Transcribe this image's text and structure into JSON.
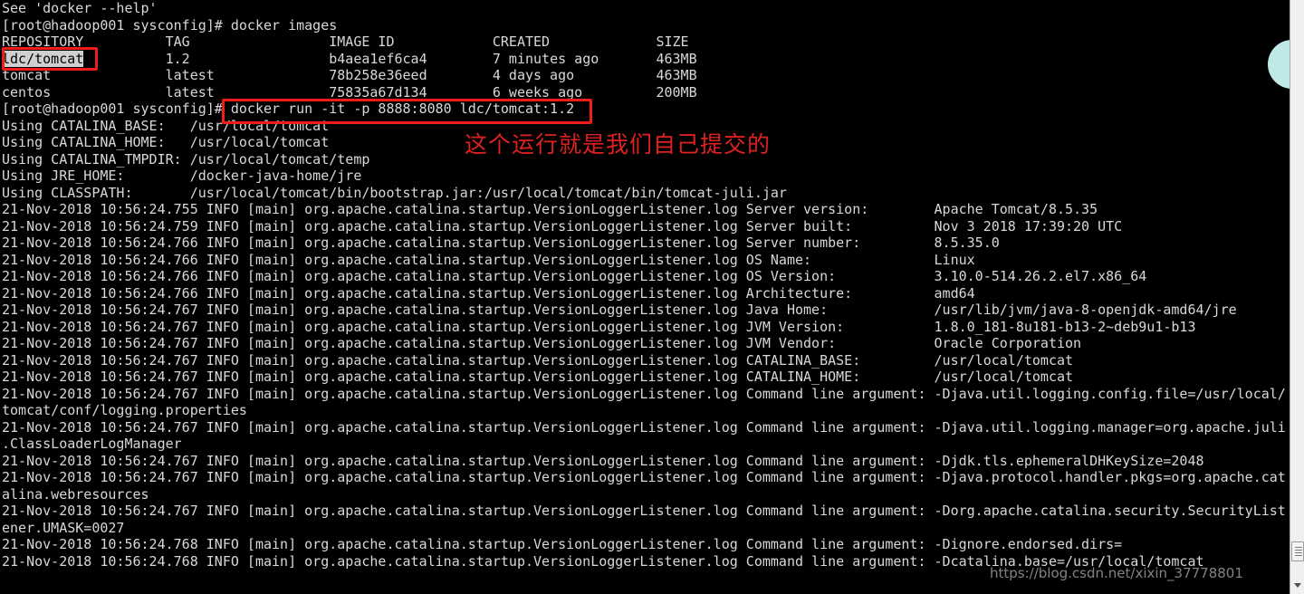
{
  "terminal": {
    "prompt": "[root@hadoop001 sysconfig]#",
    "lines": [
      {
        "id": "help-hint",
        "text": "See 'docker --help'"
      },
      {
        "id": "cmd-docker-images",
        "text": "[root@hadoop001 sysconfig]# docker images"
      },
      {
        "id": "images-header",
        "text": "REPOSITORY          TAG                 IMAGE ID            CREATED             SIZE"
      },
      {
        "id": "image-row-1",
        "pre": "",
        "sel": "ldc/tomcat",
        "post": "          1.2                 b4aea1ef6ca4        7 minutes ago       463MB"
      },
      {
        "id": "image-row-2",
        "text": "tomcat              latest              78b258e36eed        4 days ago          463MB"
      },
      {
        "id": "image-row-3",
        "text": "centos              latest              75835a67d134        6 weeks ago         200MB"
      },
      {
        "id": "cmd-docker-run",
        "text": "[root@hadoop001 sysconfig]# docker run -it -p 8888:8080 ldc/tomcat:1.2"
      },
      {
        "id": "catalina-base",
        "text": "Using CATALINA_BASE:   /usr/local/tomcat"
      },
      {
        "id": "catalina-home",
        "text": "Using CATALINA_HOME:   /usr/local/tomcat"
      },
      {
        "id": "catalina-tmpdir",
        "text": "Using CATALINA_TMPDIR: /usr/local/tomcat/temp"
      },
      {
        "id": "jre-home",
        "text": "Using JRE_HOME:        /docker-java-home/jre"
      },
      {
        "id": "classpath",
        "text": "Using CLASSPATH:       /usr/local/tomcat/bin/bootstrap.jar:/usr/local/tomcat/bin/tomcat-juli.jar"
      },
      {
        "id": "log-server-version",
        "text": "21-Nov-2018 10:56:24.755 INFO [main] org.apache.catalina.startup.VersionLoggerListener.log Server version:        Apache Tomcat/8.5.35"
      },
      {
        "id": "log-server-built",
        "text": "21-Nov-2018 10:56:24.759 INFO [main] org.apache.catalina.startup.VersionLoggerListener.log Server built:          Nov 3 2018 17:39:20 UTC"
      },
      {
        "id": "log-server-number",
        "text": "21-Nov-2018 10:56:24.766 INFO [main] org.apache.catalina.startup.VersionLoggerListener.log Server number:         8.5.35.0"
      },
      {
        "id": "log-os-name",
        "text": "21-Nov-2018 10:56:24.766 INFO [main] org.apache.catalina.startup.VersionLoggerListener.log OS Name:               Linux"
      },
      {
        "id": "log-os-version",
        "text": "21-Nov-2018 10:56:24.766 INFO [main] org.apache.catalina.startup.VersionLoggerListener.log OS Version:            3.10.0-514.26.2.el7.x86_64"
      },
      {
        "id": "log-architecture",
        "text": "21-Nov-2018 10:56:24.766 INFO [main] org.apache.catalina.startup.VersionLoggerListener.log Architecture:          amd64"
      },
      {
        "id": "log-java-home",
        "text": "21-Nov-2018 10:56:24.767 INFO [main] org.apache.catalina.startup.VersionLoggerListener.log Java Home:             /usr/lib/jvm/java-8-openjdk-amd64/jre"
      },
      {
        "id": "log-jvm-version",
        "text": "21-Nov-2018 10:56:24.767 INFO [main] org.apache.catalina.startup.VersionLoggerListener.log JVM Version:           1.8.0_181-8u181-b13-2~deb9u1-b13"
      },
      {
        "id": "log-jvm-vendor",
        "text": "21-Nov-2018 10:56:24.767 INFO [main] org.apache.catalina.startup.VersionLoggerListener.log JVM Vendor:            Oracle Corporation"
      },
      {
        "id": "log-catalina-base",
        "text": "21-Nov-2018 10:56:24.767 INFO [main] org.apache.catalina.startup.VersionLoggerListener.log CATALINA_BASE:         /usr/local/tomcat"
      },
      {
        "id": "log-catalina-home",
        "text": "21-Nov-2018 10:56:24.767 INFO [main] org.apache.catalina.startup.VersionLoggerListener.log CATALINA_HOME:         /usr/local/tomcat"
      },
      {
        "id": "log-arg-logging-config",
        "text": "21-Nov-2018 10:56:24.767 INFO [main] org.apache.catalina.startup.VersionLoggerListener.log Command line argument: -Djava.util.logging.config.file=/usr/local/"
      },
      {
        "id": "log-arg-logging-config-wrap",
        "text": "tomcat/conf/logging.properties"
      },
      {
        "id": "log-arg-logging-manager",
        "text": "21-Nov-2018 10:56:24.767 INFO [main] org.apache.catalina.startup.VersionLoggerListener.log Command line argument: -Djava.util.logging.manager=org.apache.juli"
      },
      {
        "id": "log-arg-logging-manager-wrap",
        "text": ".ClassLoaderLogManager"
      },
      {
        "id": "log-arg-dhkeysize",
        "text": "21-Nov-2018 10:56:24.767 INFO [main] org.apache.catalina.startup.VersionLoggerListener.log Command line argument: -Djdk.tls.ephemeralDHKeySize=2048"
      },
      {
        "id": "log-arg-protocol-handler",
        "text": "21-Nov-2018 10:56:24.767 INFO [main] org.apache.catalina.startup.VersionLoggerListener.log Command line argument: -Djava.protocol.handler.pkgs=org.apache.cat"
      },
      {
        "id": "log-arg-protocol-handler-wrap",
        "text": "alina.webresources"
      },
      {
        "id": "log-arg-security-listener",
        "text": "21-Nov-2018 10:56:24.767 INFO [main] org.apache.catalina.startup.VersionLoggerListener.log Command line argument: -Dorg.apache.catalina.security.SecurityList"
      },
      {
        "id": "log-arg-security-listener-wrap",
        "text": "ener.UMASK=0027"
      },
      {
        "id": "log-arg-ignore-endorsed",
        "text": "21-Nov-2018 10:56:24.768 INFO [main] org.apache.catalina.startup.VersionLoggerListener.log Command line argument: -Dignore.endorsed.dirs="
      },
      {
        "id": "log-arg-catalina-base",
        "text": "21-Nov-2018 10:56:24.768 INFO [main] org.apache.catalina.startup.VersionLoggerListener.log Command line argument: -Dcatalina.base=/usr/local/tomcat"
      }
    ]
  },
  "annotations": {
    "chinese_note": "这个运行就是我们自己提交的",
    "highlight_color": "#ef1c18",
    "note_color": "#e02020",
    "box_image_label": "ldc/tomcat",
    "box_command_label": "docker run -it -p 8888:8080 ldc/tomcat:1.2"
  },
  "watermark": {
    "text": "https://blog.csdn.net/xixin_37778801"
  },
  "scrollbar": {
    "position": "bottom",
    "thumb_label": "scroll-thumb",
    "down_arrow_label": "▼"
  }
}
